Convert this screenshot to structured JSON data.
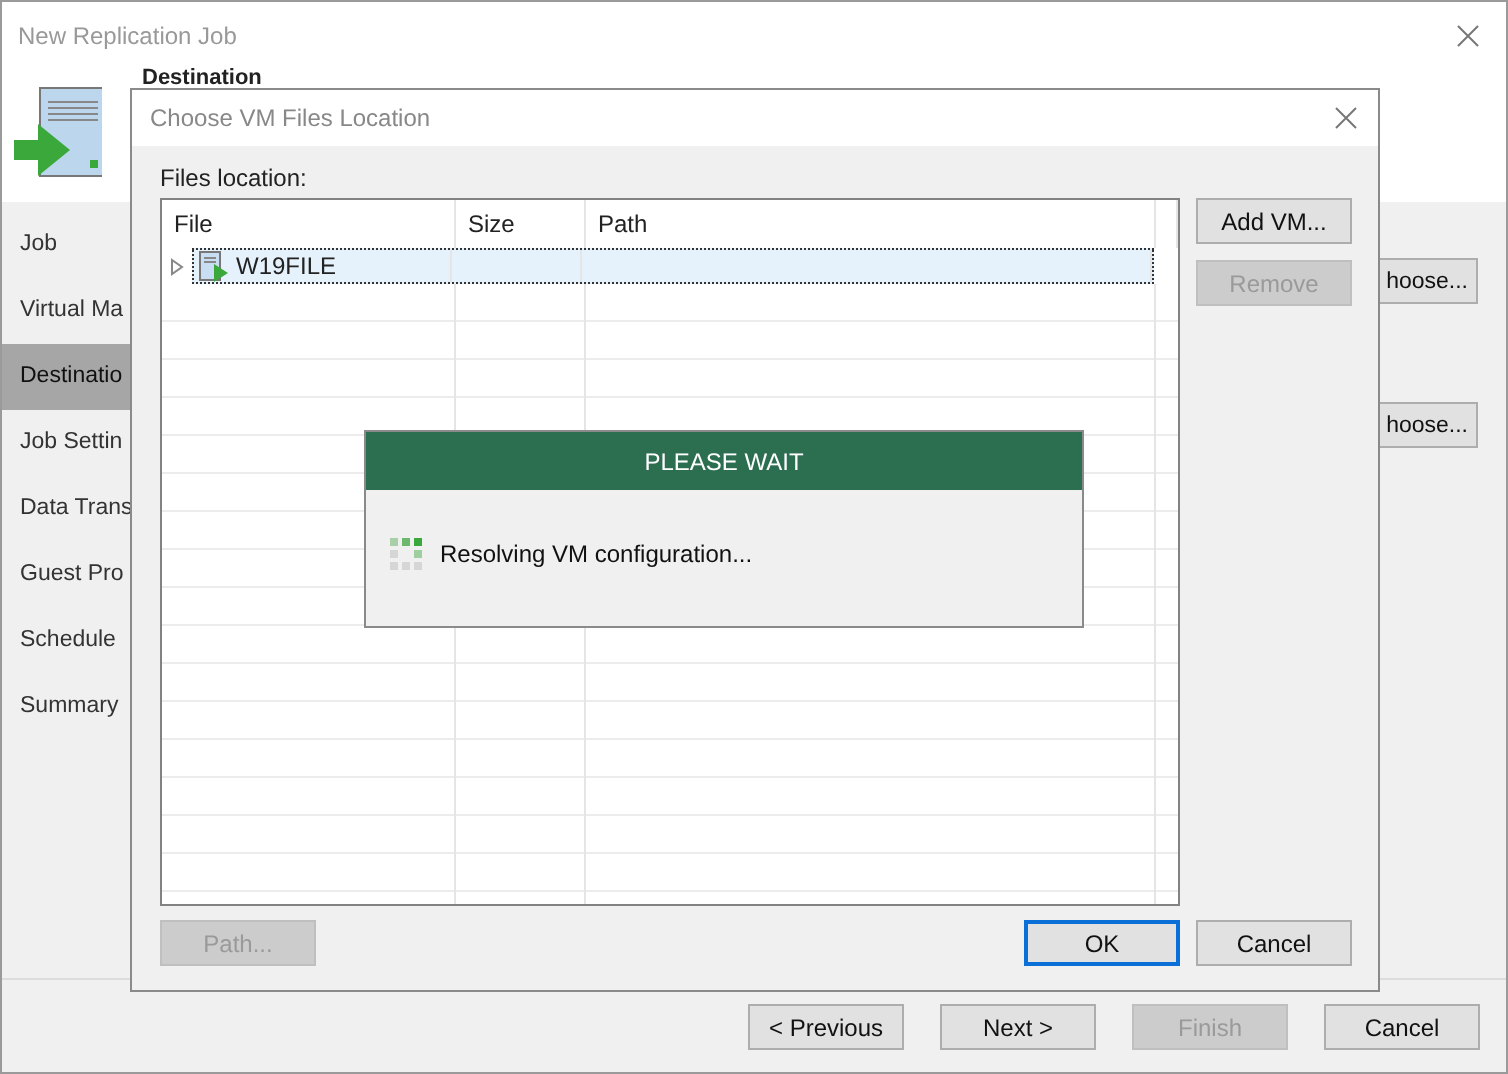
{
  "window": {
    "title": "New Replication Job",
    "header_title": "Destination"
  },
  "sidebar": {
    "items": [
      {
        "label": "Job",
        "selected": false
      },
      {
        "label": "Virtual Ma",
        "selected": false
      },
      {
        "label": "Destinatio",
        "selected": true
      },
      {
        "label": "Job Settin",
        "selected": false
      },
      {
        "label": "Data Trans",
        "selected": false
      },
      {
        "label": "Guest Pro",
        "selected": false
      },
      {
        "label": "Schedule",
        "selected": false
      },
      {
        "label": "Summary",
        "selected": false
      }
    ]
  },
  "content": {
    "choose_buttons": [
      "hoose...",
      "hoose..."
    ]
  },
  "footer": {
    "buttons": [
      {
        "label": "< Previous",
        "disabled": false
      },
      {
        "label": "Next >",
        "disabled": false
      },
      {
        "label": "Finish",
        "disabled": true
      },
      {
        "label": "Cancel",
        "disabled": false
      }
    ]
  },
  "dialog": {
    "title": "Choose VM Files Location",
    "files_label": "Files location:",
    "table": {
      "columns": [
        "File",
        "Size",
        "Path"
      ],
      "rows": [
        {
          "file": "W19FILE",
          "size": "",
          "path": "",
          "selected": true,
          "expanded": false
        }
      ]
    },
    "side_buttons": [
      {
        "label": "Add VM...",
        "disabled": false
      },
      {
        "label": "Remove",
        "disabled": true
      }
    ],
    "path_button": {
      "label": "Path...",
      "disabled": true
    },
    "buttons": [
      {
        "label": "OK",
        "default": true
      },
      {
        "label": "Cancel",
        "default": false
      }
    ]
  },
  "progress": {
    "title": "PLEASE WAIT",
    "message": "Resolving VM configuration..."
  }
}
